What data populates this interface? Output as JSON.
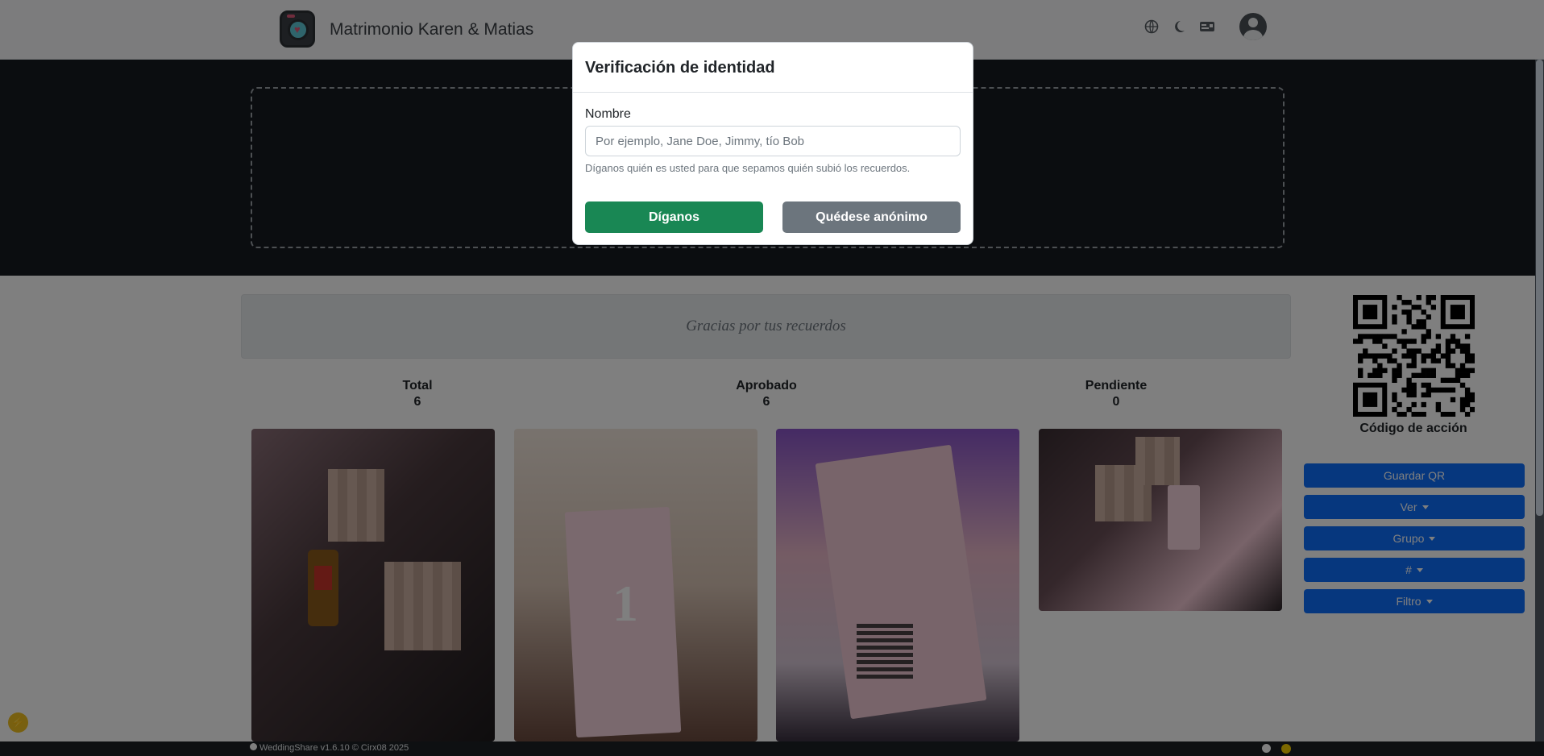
{
  "navbar": {
    "title": "Matrimonio Karen & Matias",
    "icons": [
      "language-icon",
      "moon-icon",
      "id-card-icon",
      "user-avatar-icon"
    ]
  },
  "main": {
    "thanks": "Gracias por tus recuerdos",
    "stats": [
      {
        "label": "Total",
        "value": "6"
      },
      {
        "label": "Aprobado",
        "value": "6"
      },
      {
        "label": "Pendiente",
        "value": "0"
      }
    ]
  },
  "sidebar": {
    "qr_label": "Código de acción",
    "buttons": {
      "save_qr": "Guardar QR",
      "view": "Ver",
      "group": "Grupo",
      "hash": "#",
      "filter": "Filtro"
    }
  },
  "modal": {
    "title": "Verificación de identidad",
    "field_label": "Nombre",
    "placeholder": "Por ejemplo, Jane Doe, Jimmy, tío Bob",
    "help": "Díganos quién es usted para que sepamos quién subió los recuerdos.",
    "primary_button": "Díganos",
    "secondary_button": "Quédese anónimo"
  },
  "footer": {
    "text": "WeddingShare v1.6.10 © Cirx08 2025"
  },
  "colors": {
    "primary": "#0d6efd",
    "success": "#198754",
    "secondary": "#6c757d",
    "hero": "#161a20"
  }
}
